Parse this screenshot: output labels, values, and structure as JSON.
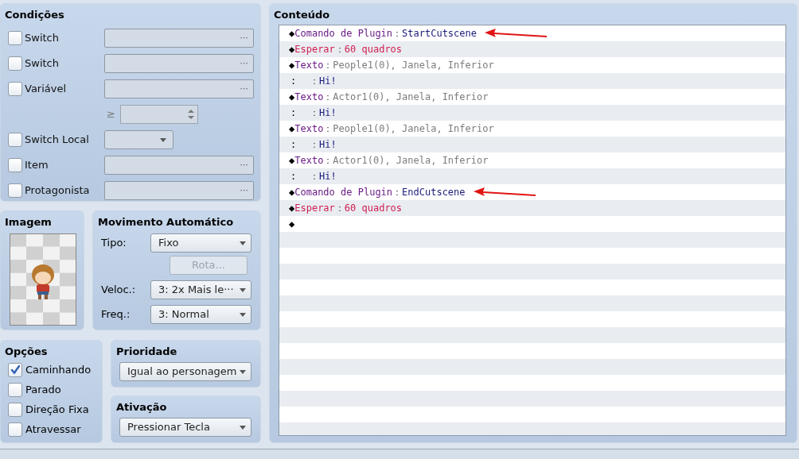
{
  "conditions": {
    "title": "Condições",
    "rows": [
      {
        "kind": "picker",
        "label": "Switch",
        "checked": false,
        "button": "···"
      },
      {
        "kind": "picker",
        "label": "Switch",
        "checked": false,
        "button": "···"
      },
      {
        "kind": "picker",
        "label": "Variável",
        "checked": false,
        "button": "···"
      },
      {
        "kind": "spinner",
        "operator": "≥"
      },
      {
        "kind": "dropdown",
        "label": "Switch Local",
        "checked": false
      },
      {
        "kind": "picker",
        "label": "Item",
        "checked": false,
        "button": "···"
      },
      {
        "kind": "picker",
        "label": "Protagonista",
        "checked": false,
        "button": "···"
      }
    ]
  },
  "image": {
    "title": "Imagem"
  },
  "movement": {
    "title": "Movimento Automático",
    "type_label": "Tipo:",
    "type_value": "Fixo",
    "route_button": {
      "label": "Rota...",
      "disabled": true
    },
    "speed_label": "Veloc.:",
    "speed_value": "3: 2x Mais le···",
    "freq_label": "Freq.:",
    "freq_value": "3: Normal"
  },
  "options": {
    "title": "Opções",
    "items": [
      {
        "label": "Caminhando",
        "checked": true
      },
      {
        "label": "Parado",
        "checked": false
      },
      {
        "label": "Direção Fixa",
        "checked": false
      },
      {
        "label": "Atravessar",
        "checked": false
      }
    ]
  },
  "priority": {
    "title": "Prioridade",
    "value": "Igual ao personagem"
  },
  "trigger": {
    "title": "Ativação",
    "value": "Pressionar Tecla"
  },
  "contents": {
    "title": "Conteúdo",
    "events": [
      {
        "kind": "plugin",
        "marker": "◆",
        "command": "Comando de Plugin",
        "sep": "：",
        "args": "StartCutscene",
        "annotated": true
      },
      {
        "kind": "wait",
        "marker": "◆",
        "command": "Esperar",
        "sep": "：",
        "args": "60 quadros",
        "annotated": false
      },
      {
        "kind": "text",
        "marker": "◆",
        "command": "Texto",
        "sep": "：",
        "args": "People1(0), Janela, Inferior",
        "annotated": false
      },
      {
        "kind": "line",
        "marker": ":",
        "sep": "：",
        "args": "Hi!",
        "annotated": false
      },
      {
        "kind": "text",
        "marker": "◆",
        "command": "Texto",
        "sep": "：",
        "args": "Actor1(0), Janela, Inferior",
        "annotated": false
      },
      {
        "kind": "line",
        "marker": ":",
        "sep": "：",
        "args": "Hi!",
        "annotated": false
      },
      {
        "kind": "text",
        "marker": "◆",
        "command": "Texto",
        "sep": "：",
        "args": "People1(0), Janela, Inferior",
        "annotated": false
      },
      {
        "kind": "line",
        "marker": ":",
        "sep": "：",
        "args": "Hi!",
        "annotated": false
      },
      {
        "kind": "text",
        "marker": "◆",
        "command": "Texto",
        "sep": "：",
        "args": "Actor1(0), Janela, Inferior",
        "annotated": false
      },
      {
        "kind": "line",
        "marker": ":",
        "sep": "：",
        "args": "Hi!",
        "annotated": false
      },
      {
        "kind": "plugin",
        "marker": "◆",
        "command": "Comando de Plugin",
        "sep": "：",
        "args": "EndCutscene",
        "annotated": true
      },
      {
        "kind": "wait",
        "marker": "◆",
        "command": "Esperar",
        "sep": "：",
        "args": "60 quadros",
        "annotated": false
      },
      {
        "kind": "empty",
        "marker": "◆",
        "annotated": false
      }
    ]
  }
}
